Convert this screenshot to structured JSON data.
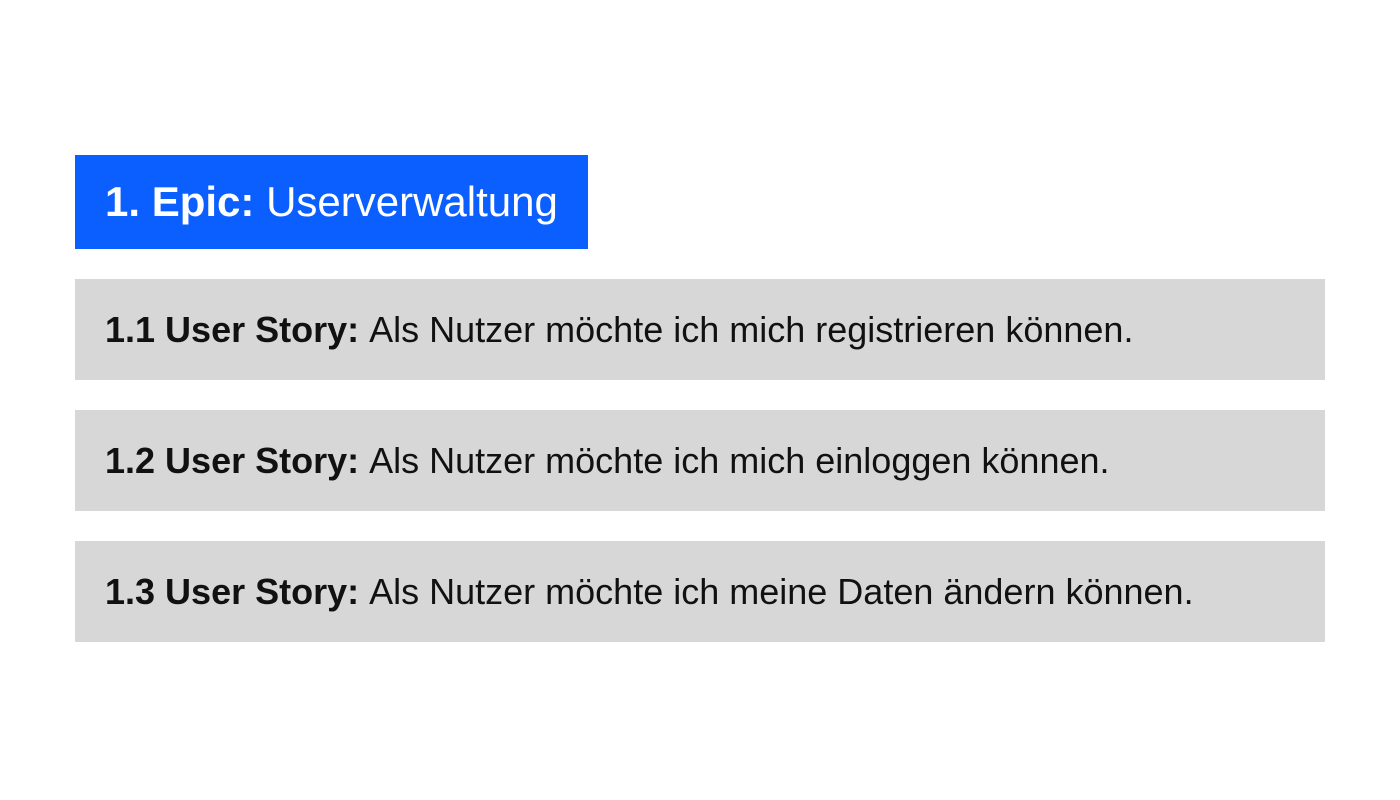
{
  "epic": {
    "label": "1. Epic: ",
    "title": "Userverwaltung"
  },
  "stories": [
    {
      "label": "1.1 User Story: ",
      "desc": "Als Nutzer möchte ich mich registrieren können."
    },
    {
      "label": "1.2 User Story: ",
      "desc": "Als Nutzer möchte ich mich einloggen können."
    },
    {
      "label": "1.3 User Story: ",
      "desc": "Als Nutzer möchte ich meine Daten ändern können."
    }
  ]
}
